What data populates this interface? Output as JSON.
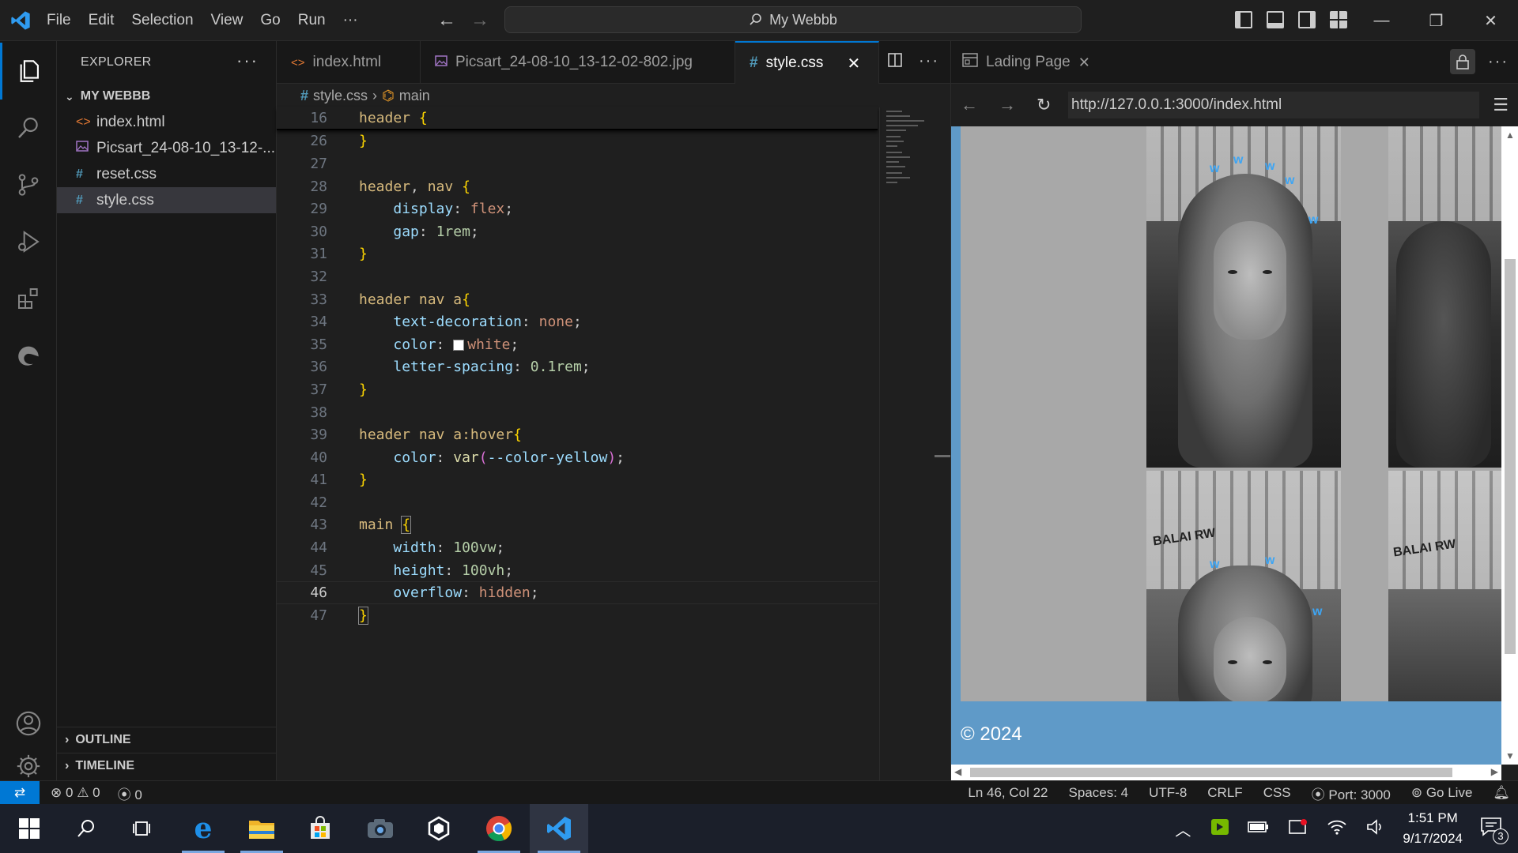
{
  "window": {
    "search_title": "My Webbb",
    "menu": [
      "File",
      "Edit",
      "Selection",
      "View",
      "Go",
      "Run",
      "···"
    ]
  },
  "sidebar": {
    "title": "EXPLORER",
    "more": "···",
    "folder": "MY WEBBB",
    "files": [
      {
        "name": "index.html",
        "icon": "<>",
        "color": "#e37933"
      },
      {
        "name": "Picsart_24-08-10_13-12-...",
        "icon": "img",
        "color": "#a074c4"
      },
      {
        "name": "reset.css",
        "icon": "#",
        "color": "#519aba"
      },
      {
        "name": "style.css",
        "icon": "#",
        "color": "#519aba"
      }
    ],
    "outline": "OUTLINE",
    "timeline": "TIMELINE"
  },
  "editor": {
    "tabs": [
      "index.html",
      "Picsart_24-08-10_13-12-02-802.jpg",
      "style.css"
    ],
    "breadcrumb": {
      "file": "style.css",
      "symbol": "main"
    },
    "lines": [
      {
        "n": "16",
        "text": "header {"
      },
      {
        "n": "26",
        "text": "}"
      },
      {
        "n": "27",
        "text": ""
      },
      {
        "n": "28",
        "text": "header, nav {"
      },
      {
        "n": "29",
        "text": "    display: flex;"
      },
      {
        "n": "30",
        "text": "    gap: 1rem;"
      },
      {
        "n": "31",
        "text": "}"
      },
      {
        "n": "32",
        "text": ""
      },
      {
        "n": "33",
        "text": "header nav a{"
      },
      {
        "n": "34",
        "text": "    text-decoration: none;"
      },
      {
        "n": "35",
        "text": "    color: white;"
      },
      {
        "n": "36",
        "text": "    letter-spacing: 0.1rem;"
      },
      {
        "n": "37",
        "text": "}"
      },
      {
        "n": "38",
        "text": ""
      },
      {
        "n": "39",
        "text": "header nav a:hover{"
      },
      {
        "n": "40",
        "text": "    color: var(--color-yellow);"
      },
      {
        "n": "41",
        "text": "}"
      },
      {
        "n": "42",
        "text": ""
      },
      {
        "n": "43",
        "text": "main {"
      },
      {
        "n": "44",
        "text": "    width: 100vw;"
      },
      {
        "n": "45",
        "text": "    height: 100vh;"
      },
      {
        "n": "46",
        "text": "    overflow: hidden;"
      },
      {
        "n": "47",
        "text": "}"
      }
    ]
  },
  "preview": {
    "tab_title": "Lading Page",
    "url": "http://127.0.0.1:3000/index.html",
    "footer": "© 2024",
    "sign_text": "BALAI RW"
  },
  "status": {
    "errors": "0",
    "warnings": "0",
    "ports": "0",
    "position": "Ln 46, Col 22",
    "spaces": "Spaces: 4",
    "encoding": "UTF-8",
    "eol": "CRLF",
    "language": "CSS",
    "port": "Port: 3000",
    "golive": "Go Live"
  },
  "taskbar": {
    "time": "1:51 PM",
    "date": "9/17/2024",
    "notifications": "3"
  },
  "colors": {
    "accent": "#0078d4",
    "preview_footer": "#5f9ac8"
  }
}
